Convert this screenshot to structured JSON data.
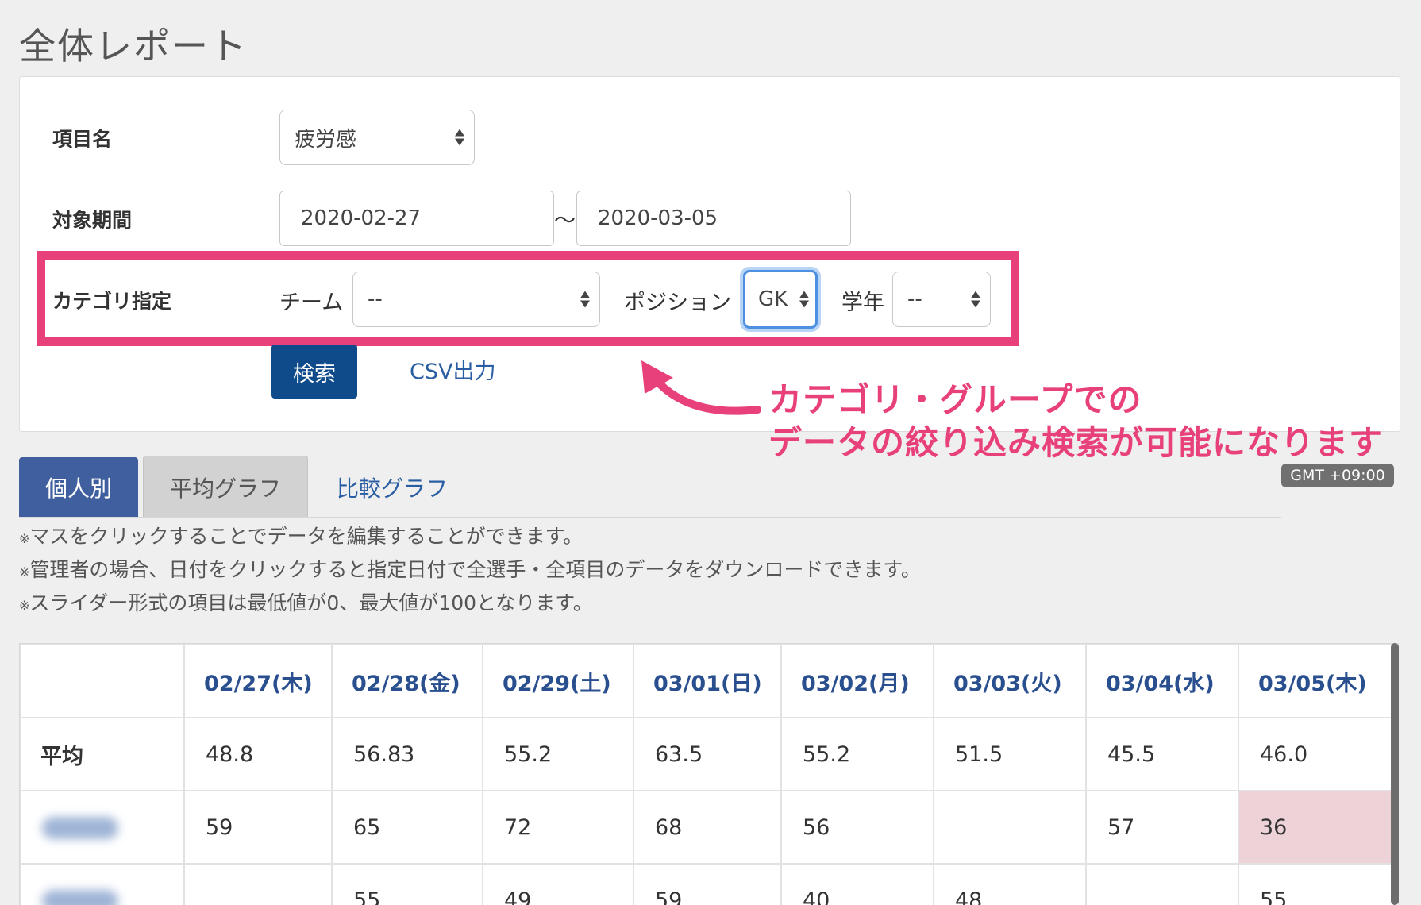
{
  "page": {
    "title": "全体レポート"
  },
  "filters": {
    "item": {
      "label": "項目名",
      "value": "疲労感"
    },
    "period": {
      "label": "対象期間",
      "start": "2020-02-27",
      "separator": "〜",
      "end": "2020-03-05"
    },
    "category": {
      "label": "カテゴリ指定",
      "team": {
        "label": "チーム",
        "value": "--"
      },
      "position": {
        "label": "ポジション",
        "value": "GK"
      },
      "grade": {
        "label": "学年",
        "value": "--"
      }
    },
    "search_label": "検索",
    "csv_label": "CSV出力"
  },
  "annotation": {
    "line1": "カテゴリ・グループでの",
    "line2": "データの絞り込み検索が可能になります",
    "color": "#e8407a"
  },
  "timezone": "GMT +09:00",
  "tabs": [
    {
      "label": "個人別",
      "state": "active"
    },
    {
      "label": "平均グラフ",
      "state": "inactive"
    },
    {
      "label": "比較グラフ",
      "state": "link"
    }
  ],
  "notes": [
    {
      "mark": "※",
      "text": "マスをクリックすることでデータを編集することができます。"
    },
    {
      "mark": "※",
      "text": "管理者の場合、日付をクリックすると指定日付で全選手・全項目のデータをダウンロードできます。"
    },
    {
      "mark": "※",
      "text": "スライダー形式の項目は最低値が0、最大値が100となります。"
    }
  ],
  "table": {
    "headers": [
      "02/27(木)",
      "02/28(金)",
      "02/29(土)",
      "03/01(日)",
      "03/02(月)",
      "03/03(火)",
      "03/04(水)",
      "03/05(木)"
    ],
    "average": {
      "label": "平均",
      "values": [
        "48.8",
        "56.83",
        "55.2",
        "63.5",
        "55.2",
        "51.5",
        "45.5",
        "46.0"
      ]
    },
    "rows": [
      {
        "values": [
          "59",
          "65",
          "72",
          "68",
          "56",
          "",
          "57",
          "36"
        ]
      },
      {
        "values": [
          "",
          "55",
          "49",
          "59",
          "40",
          "48",
          "",
          "55"
        ]
      }
    ]
  },
  "colors": {
    "primary": "#0f4b8a",
    "tab_active": "#3f5f9e",
    "link": "#2a5ea3",
    "alert_cell": "#edd2d8"
  }
}
